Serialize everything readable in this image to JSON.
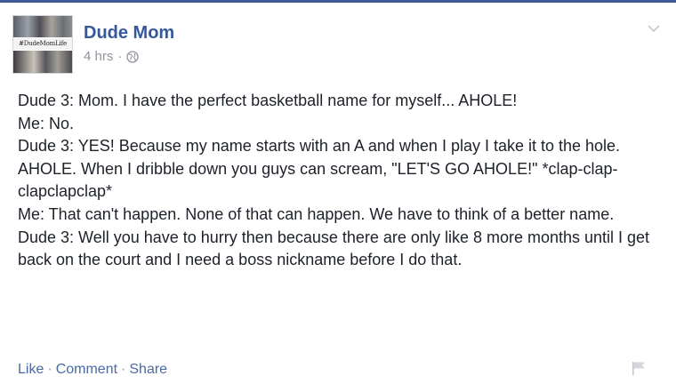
{
  "post": {
    "author": "Dude Mom",
    "timestamp": "4 hrs",
    "meta_separator": "·",
    "avatar_tag": "#DudeMomLife",
    "body_lines": [
      "Dude 3: Mom. I have the perfect basketball name for myself... AHOLE!",
      "Me: No.",
      "Dude 3: YES! Because my name starts with an A and when I play I take it to the hole. AHOLE. When I dribble down you guys can scream, \"LET'S GO AHOLE!\" *clap-clap-clapclapclap*",
      "Me: That can't happen. None of that can happen. We have to think of a better name.",
      "Dude 3: Well you have to hurry then because there are only like 8 more months until I get back on the court and I need a boss nickname before I do that."
    ],
    "actions": {
      "like": "Like",
      "comment": "Comment",
      "share": "Share",
      "separator": "·"
    }
  },
  "icons": {
    "globe": "globe-icon",
    "chevron": "chevron-down-icon",
    "flag": "flag-icon"
  },
  "colors": {
    "brand_blue": "#365899",
    "link_blue": "#4b6aa5",
    "meta_gray": "#90949c",
    "text": "#1d2129"
  }
}
